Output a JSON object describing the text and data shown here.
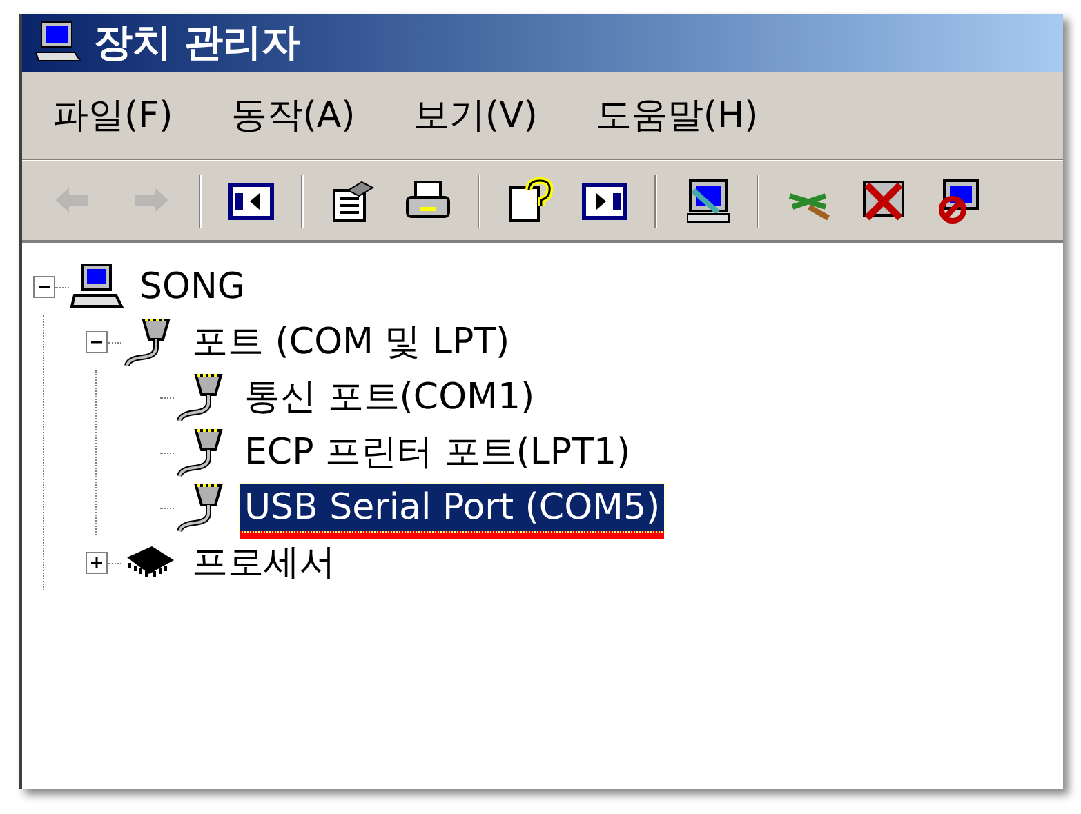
{
  "window": {
    "title": "장치 관리자"
  },
  "menu": [
    {
      "label": "파일(F)"
    },
    {
      "label": "동작(A)"
    },
    {
      "label": "보기(V)"
    },
    {
      "label": "도움말(H)"
    }
  ],
  "toolbar": [
    {
      "kind": "back",
      "disabled": true
    },
    {
      "kind": "forward",
      "disabled": true
    },
    {
      "kind": "sep"
    },
    {
      "kind": "tree-toggle",
      "disabled": false
    },
    {
      "kind": "sep"
    },
    {
      "kind": "properties",
      "disabled": false
    },
    {
      "kind": "print",
      "disabled": false
    },
    {
      "kind": "sep"
    },
    {
      "kind": "help",
      "disabled": false
    },
    {
      "kind": "panel",
      "disabled": false
    },
    {
      "kind": "sep"
    },
    {
      "kind": "scan",
      "disabled": false
    },
    {
      "kind": "sep"
    },
    {
      "kind": "update",
      "disabled": false
    },
    {
      "kind": "uninstall",
      "disabled": false
    },
    {
      "kind": "disable",
      "disabled": false
    }
  ],
  "tree": [
    {
      "label": "SONG",
      "kind": "computer",
      "expanded": true,
      "selected": false,
      "underlined": false,
      "children": [
        {
          "label": "포트 (COM 및 LPT)",
          "kind": "port",
          "expanded": true,
          "selected": false,
          "underlined": false,
          "children": [
            {
              "label": "통신 포트(COM1)",
              "kind": "port",
              "selected": false,
              "underlined": false
            },
            {
              "label": "ECP 프린터 포트(LPT1)",
              "kind": "port",
              "selected": false,
              "underlined": false
            },
            {
              "label": "USB Serial Port (COM5)",
              "kind": "port",
              "selected": true,
              "underlined": true
            }
          ]
        },
        {
          "label": "프로세서",
          "kind": "chip",
          "expanded": false,
          "selected": false,
          "underlined": false
        }
      ]
    }
  ]
}
